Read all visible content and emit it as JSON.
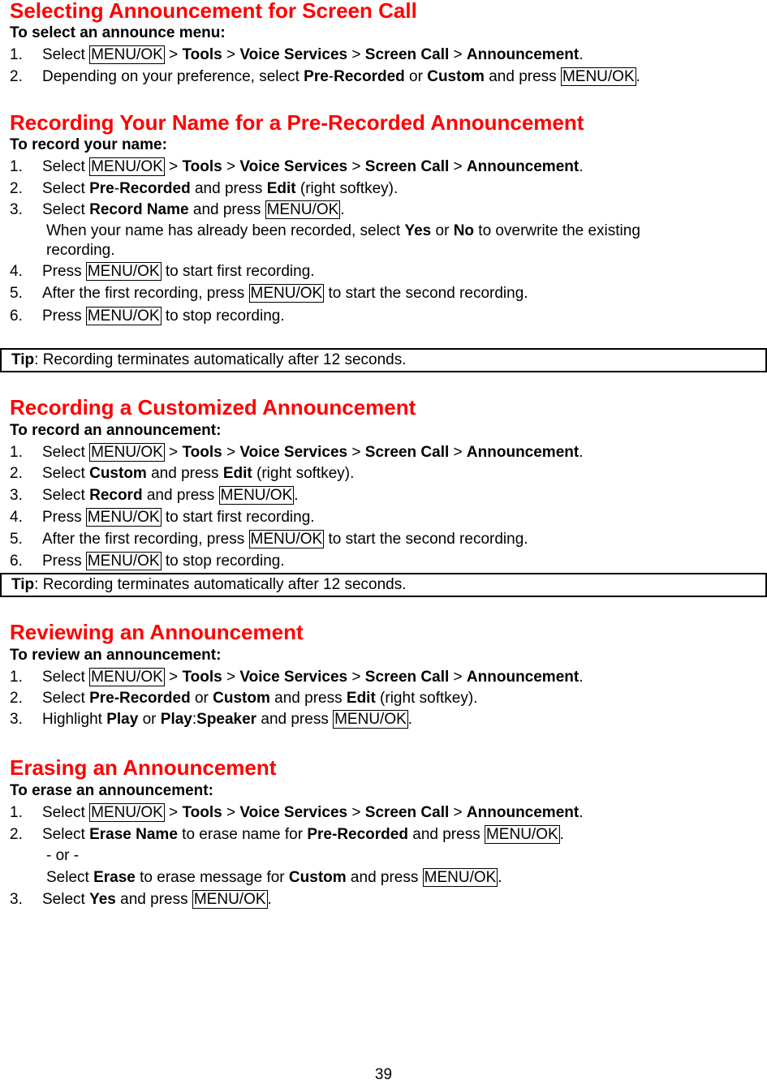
{
  "sections": [
    {
      "title": "Selecting Announcement for Screen Call",
      "subtitle": "To select an announce menu:",
      "steps": [
        {
          "num": "1.",
          "parts": [
            [
              "t",
              "Select "
            ],
            [
              "k",
              "MENU/OK"
            ],
            [
              "t",
              " > "
            ],
            [
              "b",
              "Tools"
            ],
            [
              "t",
              " > "
            ],
            [
              "b",
              "Voice Services"
            ],
            [
              "t",
              " > "
            ],
            [
              "b",
              "Screen Call"
            ],
            [
              "t",
              " > "
            ],
            [
              "b",
              "Announcement"
            ],
            [
              "t",
              "."
            ]
          ]
        },
        {
          "num": "2.",
          "parts": [
            [
              "t",
              "Depending on your preference, select "
            ],
            [
              "b",
              "Pre"
            ],
            [
              "t",
              "-"
            ],
            [
              "b",
              "Recorded"
            ],
            [
              "t",
              " or "
            ],
            [
              "b",
              "Custom"
            ],
            [
              "t",
              " and press "
            ],
            [
              "k",
              "MENU/OK"
            ],
            [
              "t",
              "."
            ]
          ]
        }
      ]
    },
    {
      "title": "Recording Your Name for a Pre-Recorded Announcement",
      "subtitle": "To record your name:",
      "steps": [
        {
          "num": "1.",
          "parts": [
            [
              "t",
              "Select "
            ],
            [
              "k",
              "MENU/OK"
            ],
            [
              "t",
              " > "
            ],
            [
              "b",
              "Tools"
            ],
            [
              "t",
              " > "
            ],
            [
              "b",
              "Voice Services"
            ],
            [
              "t",
              " > "
            ],
            [
              "b",
              "Screen Call"
            ],
            [
              "t",
              " > "
            ],
            [
              "b",
              "Announcement"
            ],
            [
              "t",
              "."
            ]
          ]
        },
        {
          "num": "2.",
          "parts": [
            [
              "t",
              "Select "
            ],
            [
              "b",
              "Pre"
            ],
            [
              "t",
              "-"
            ],
            [
              "b",
              "Recorded"
            ],
            [
              "t",
              " and press "
            ],
            [
              "b",
              "Edit"
            ],
            [
              "t",
              " (right softkey)."
            ]
          ]
        },
        {
          "num": "3.",
          "parts": [
            [
              "t",
              "Select "
            ],
            [
              "b",
              "Record Name"
            ],
            [
              "t",
              " and press "
            ],
            [
              "k",
              "MENU/OK"
            ],
            [
              "t",
              "."
            ]
          ]
        },
        {
          "num": "",
          "parts": [
            [
              "t",
              "When your name has already been recorded, select "
            ],
            [
              "b",
              "Yes"
            ],
            [
              "t",
              " or "
            ],
            [
              "b",
              "No"
            ],
            [
              "t",
              " to overwrite the existing"
            ]
          ]
        },
        {
          "num": "",
          "parts": [
            [
              "t",
              "recording."
            ]
          ]
        },
        {
          "num": "4.",
          "parts": [
            [
              "t",
              "Press "
            ],
            [
              "k",
              "MENU/OK"
            ],
            [
              "t",
              " to start first recording."
            ]
          ]
        },
        {
          "num": "5.",
          "parts": [
            [
              "t",
              "After the first recording, press "
            ],
            [
              "k",
              "MENU/OK"
            ],
            [
              "t",
              " to start the second recording."
            ]
          ]
        },
        {
          "num": "6.",
          "parts": [
            [
              "t",
              "Press "
            ],
            [
              "k",
              "MENU/OK"
            ],
            [
              "t",
              " to stop recording."
            ]
          ]
        }
      ],
      "tip": {
        "label": "Tip",
        "text": ": Recording terminates automatically after 12 seconds."
      }
    },
    {
      "title": "Recording a Customized Announcement",
      "subtitle": "To record an announcement:",
      "steps": [
        {
          "num": "1.",
          "parts": [
            [
              "t",
              "Select "
            ],
            [
              "k",
              "MENU/OK"
            ],
            [
              "t",
              " > "
            ],
            [
              "b",
              "Tools"
            ],
            [
              "t",
              " > "
            ],
            [
              "b",
              "Voice Services"
            ],
            [
              "t",
              " > "
            ],
            [
              "b",
              "Screen Call"
            ],
            [
              "t",
              " > "
            ],
            [
              "b",
              "Announcement"
            ],
            [
              "t",
              "."
            ]
          ]
        },
        {
          "num": "2.",
          "parts": [
            [
              "t",
              "Select "
            ],
            [
              "b",
              "Custom"
            ],
            [
              "t",
              " and press "
            ],
            [
              "b",
              "Edit"
            ],
            [
              "t",
              " (right softkey)."
            ]
          ]
        },
        {
          "num": "3.",
          "parts": [
            [
              "t",
              "Select "
            ],
            [
              "b",
              "Record"
            ],
            [
              "t",
              " and press "
            ],
            [
              "k",
              "MENU/OK"
            ],
            [
              "t",
              "."
            ]
          ]
        },
        {
          "num": "4.",
          "parts": [
            [
              "t",
              "Press "
            ],
            [
              "k",
              "MENU/OK"
            ],
            [
              "t",
              " to start first recording."
            ]
          ]
        },
        {
          "num": "5.",
          "parts": [
            [
              "t",
              "After the first recording, press "
            ],
            [
              "k",
              "MENU/OK"
            ],
            [
              "t",
              " to start the second recording."
            ]
          ]
        },
        {
          "num": "6.",
          "parts": [
            [
              "t",
              "Press "
            ],
            [
              "k",
              "MENU/OK"
            ],
            [
              "t",
              " to stop recording."
            ]
          ]
        }
      ],
      "tip": {
        "label": "Tip",
        "text": ": Recording terminates automatically after 12 seconds."
      }
    },
    {
      "title": "Reviewing an Announcement",
      "subtitle": "To review an announcement:",
      "steps": [
        {
          "num": "1.",
          "parts": [
            [
              "t",
              "Select "
            ],
            [
              "k",
              "MENU/OK"
            ],
            [
              "t",
              " > "
            ],
            [
              "b",
              "Tools"
            ],
            [
              "t",
              " > "
            ],
            [
              "b",
              "Voice Services"
            ],
            [
              "t",
              " > "
            ],
            [
              "b",
              "Screen Call"
            ],
            [
              "t",
              " > "
            ],
            [
              "b",
              "Announcement"
            ],
            [
              "t",
              "."
            ]
          ]
        },
        {
          "num": "2.",
          "parts": [
            [
              "t",
              "Select "
            ],
            [
              "b",
              "Pre-Recorded"
            ],
            [
              "t",
              " or "
            ],
            [
              "b",
              "Custom"
            ],
            [
              "t",
              " and press "
            ],
            [
              "b",
              "Edit"
            ],
            [
              "t",
              " (right softkey)."
            ]
          ]
        },
        {
          "num": "3.",
          "parts": [
            [
              "t",
              "Highlight "
            ],
            [
              "b",
              "Play"
            ],
            [
              "t",
              " or "
            ],
            [
              "b",
              "Play"
            ],
            [
              "t",
              ":"
            ],
            [
              "b",
              "Speaker"
            ],
            [
              "t",
              " and press "
            ],
            [
              "k",
              "MENU/OK"
            ],
            [
              "t",
              "."
            ]
          ]
        }
      ]
    },
    {
      "title": "Erasing an Announcement",
      "subtitle": "To erase an announcement:",
      "steps": [
        {
          "num": "1.",
          "parts": [
            [
              "t",
              "Select "
            ],
            [
              "k",
              "MENU/OK"
            ],
            [
              "t",
              " > "
            ],
            [
              "b",
              "Tools"
            ],
            [
              "t",
              " > "
            ],
            [
              "b",
              "Voice Services"
            ],
            [
              "t",
              " > "
            ],
            [
              "b",
              "Screen Call"
            ],
            [
              "t",
              " > "
            ],
            [
              "b",
              "Announcement"
            ],
            [
              "t",
              "."
            ]
          ]
        },
        {
          "num": "2.",
          "parts": [
            [
              "t",
              "Select "
            ],
            [
              "b",
              "Erase Name"
            ],
            [
              "t",
              " to erase name for "
            ],
            [
              "b",
              "Pre-Recorded"
            ],
            [
              "t",
              " and press "
            ],
            [
              "k",
              "MENU/OK"
            ],
            [
              "t",
              "."
            ]
          ]
        },
        {
          "num": "",
          "parts": [
            [
              "t",
              "- or -"
            ]
          ]
        },
        {
          "num": "",
          "parts": [
            [
              "t",
              "Select "
            ],
            [
              "b",
              "Erase"
            ],
            [
              "t",
              " to erase message for "
            ],
            [
              "b",
              "Custom"
            ],
            [
              "t",
              " and press "
            ],
            [
              "k",
              "MENU/OK"
            ],
            [
              "t",
              "."
            ]
          ]
        },
        {
          "num": "3.",
          "parts": [
            [
              "t",
              "Select "
            ],
            [
              "b",
              "Yes"
            ],
            [
              "t",
              " and press "
            ],
            [
              "k",
              "MENU/OK"
            ],
            [
              "t",
              "."
            ]
          ]
        }
      ]
    }
  ],
  "page_number": "39"
}
